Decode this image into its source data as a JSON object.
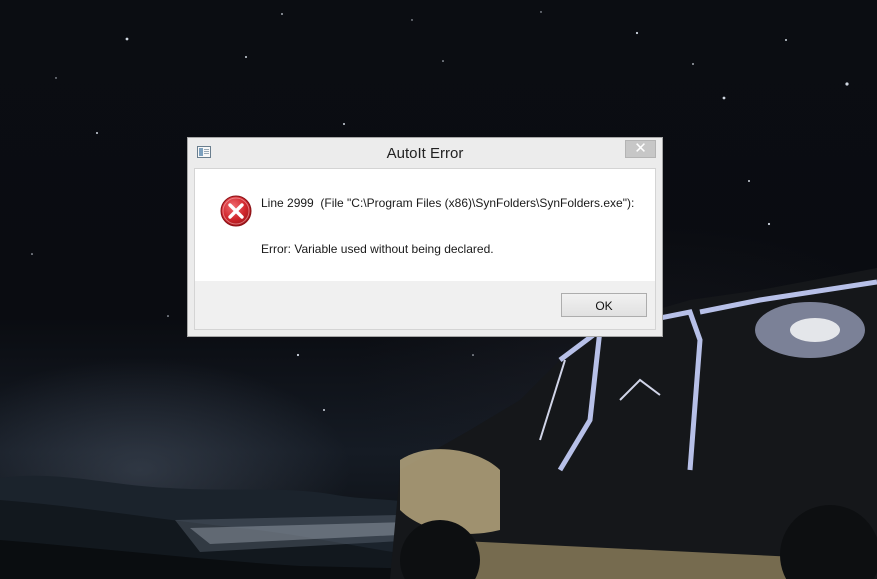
{
  "dialog": {
    "title": "AutoIt Error",
    "close_label": "✕",
    "message_line1": "Line 2999  (File \"C:\\Program Files (x86)\\SynFolders\\SynFolders.exe\"):",
    "message_line2": "Error: Variable used without being declared.",
    "ok_label": "OK"
  },
  "icons": {
    "app": "autoit-window-icon",
    "error": "error-x-icon",
    "close": "close-icon"
  },
  "colors": {
    "error_red": "#d0262c",
    "dialog_bg": "#f0f0f0",
    "message_bg": "#ffffff"
  }
}
